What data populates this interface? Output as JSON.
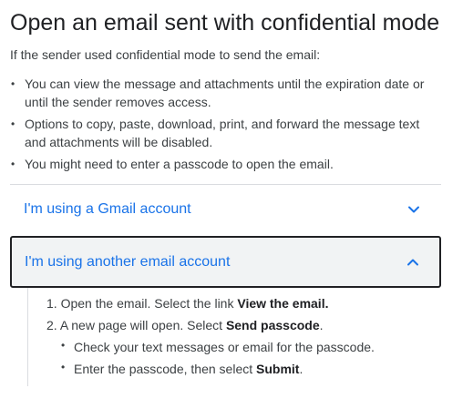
{
  "article": {
    "title": "Open an email sent with confidential mode",
    "intro": "If the sender used confidential mode to send the email:",
    "bullets": [
      "You can view the message and attachments until the expiration date or until the sender removes access.",
      "Options to copy, paste, download, print, and forward the message text and attachments will be disabled.",
      "You might need to enter a passcode to open the email."
    ]
  },
  "accordion": {
    "gmail": {
      "label": "I'm using a Gmail account",
      "icon": "chevron-down-icon",
      "expanded": false
    },
    "other": {
      "label": "I'm using another email account",
      "icon": "chevron-up-icon",
      "expanded": true,
      "steps": [
        {
          "num": "1.",
          "text": "Open the email. Select the link ",
          "bold": "View the email.",
          "after": ""
        },
        {
          "num": "2.",
          "text": "A new page will open. Select ",
          "bold": "Send passcode",
          "after": "."
        }
      ],
      "substeps": [
        {
          "text": "Check your text messages or email for the passcode.",
          "bold": "",
          "after": ""
        },
        {
          "text": "Enter the passcode, then select ",
          "bold": "Submit",
          "after": "."
        }
      ]
    }
  },
  "colors": {
    "link": "#1a73e8",
    "text": "#3c4043",
    "title": "#202124",
    "divider": "#dadce0",
    "expanded_bg": "#f1f3f4",
    "focus_border": "#202124"
  }
}
